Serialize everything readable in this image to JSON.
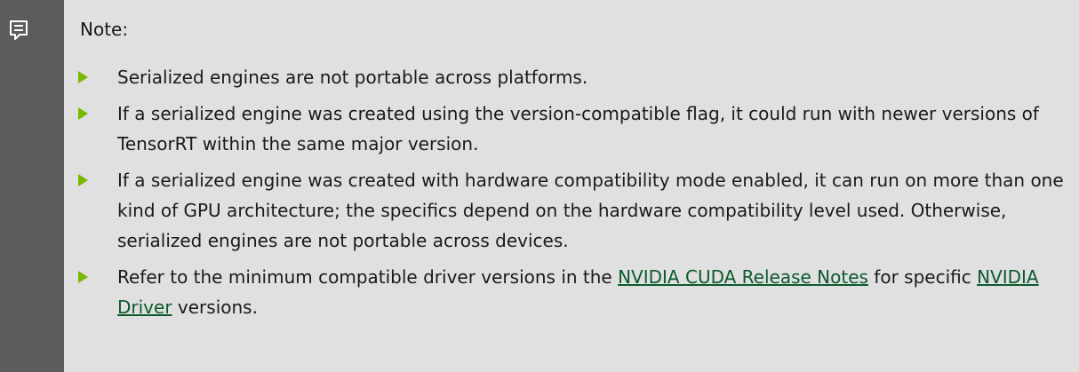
{
  "note": {
    "icon": "note-icon",
    "title": "Note:",
    "accent_color": "#76b900",
    "items": [
      {
        "text": "Serialized engines are not portable across platforms."
      },
      {
        "text": "If a serialized engine was created using the version-compatible flag, it could run with newer versions of TensorRT within the same major version."
      },
      {
        "text": "If a serialized engine was created with hardware compatibility mode enabled, it can run on more than one kind of GPU architecture; the specifics depend on the hardware compatibility level used. Otherwise, serialized engines are not portable across devices."
      },
      {
        "text_before": "Refer to the minimum compatible driver versions in the ",
        "link1": "NVIDIA CUDA Release Notes",
        "text_middle": " for specific ",
        "link2": "NVIDIA Driver",
        "text_after": " versions."
      }
    ]
  }
}
